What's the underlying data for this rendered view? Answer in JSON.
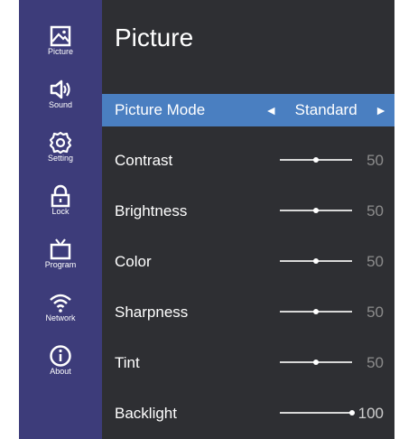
{
  "sidebar": {
    "items": [
      {
        "label": "Picture",
        "icon": "picture-icon"
      },
      {
        "label": "Sound",
        "icon": "speaker-icon"
      },
      {
        "label": "Setting",
        "icon": "gear-icon"
      },
      {
        "label": "Lock",
        "icon": "lock-icon"
      },
      {
        "label": "Program",
        "icon": "tv-icon"
      },
      {
        "label": "Network",
        "icon": "wifi-icon"
      },
      {
        "label": "About",
        "icon": "info-icon"
      }
    ]
  },
  "header": {
    "title": "Picture"
  },
  "menu": {
    "picture_mode": {
      "label": "Picture Mode",
      "value": "Standard",
      "left_arrow": "◄",
      "right_arrow": "►"
    },
    "rows": [
      {
        "label": "Contrast",
        "value": "50",
        "level": 0.5
      },
      {
        "label": "Brightness",
        "value": "50",
        "level": 0.5
      },
      {
        "label": "Color",
        "value": "50",
        "level": 0.5
      },
      {
        "label": "Sharpness",
        "value": "50",
        "level": 0.5
      },
      {
        "label": "Tint",
        "value": "50",
        "level": 0.5
      },
      {
        "label": "Backlight",
        "value": "100",
        "level": 1.0
      }
    ]
  },
  "colors": {
    "sidebar": "#3d3c7a",
    "panel": "#2e2f33",
    "highlight": "#4a7fc1"
  }
}
